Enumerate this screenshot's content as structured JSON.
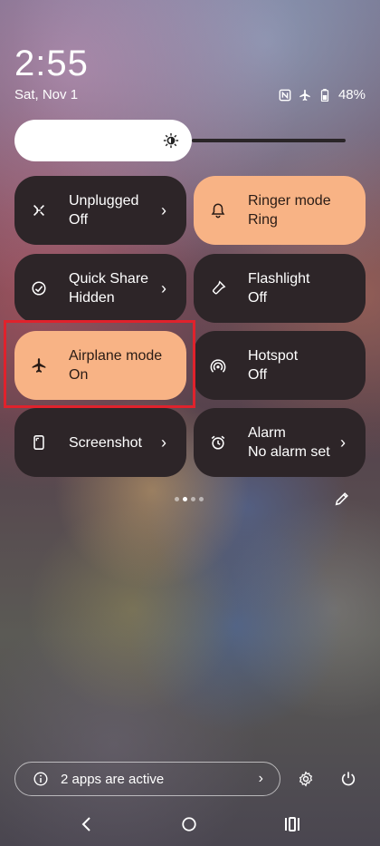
{
  "status_bar": {
    "time": "2:55",
    "date": "Sat, Nov 1",
    "battery": "48%",
    "icons": [
      "nfc-icon",
      "airplane-icon",
      "battery-icon"
    ]
  },
  "brightness": {
    "icon": "brightness-icon",
    "level": 0.45
  },
  "tiles": [
    {
      "label": "Unplugged",
      "status": "Off",
      "icon": "unplugged-icon",
      "active": false,
      "chevron": true
    },
    {
      "label": "Ringer mode",
      "status": "Ring",
      "icon": "bell-icon",
      "active": true,
      "chevron": false
    },
    {
      "label": "Quick Share",
      "status": "Hidden",
      "icon": "quick-share-icon",
      "active": false,
      "chevron": true
    },
    {
      "label": "Flashlight",
      "status": "Off",
      "icon": "flashlight-icon",
      "active": false,
      "chevron": false
    },
    {
      "label": "Airplane mode",
      "status": "On",
      "icon": "airplane-icon",
      "active": true,
      "chevron": false
    },
    {
      "label": "Hotspot",
      "status": "Off",
      "icon": "hotspot-icon",
      "active": false,
      "chevron": false
    },
    {
      "label": "Screenshot",
      "status": "",
      "icon": "screenshot-icon",
      "active": false,
      "chevron": true
    },
    {
      "label": "Alarm",
      "status": "No alarm set",
      "icon": "alarm-icon",
      "active": false,
      "chevron": true
    }
  ],
  "page_indicator": {
    "pages": 4,
    "current": 1
  },
  "footer": {
    "apps_active": "2 apps are active",
    "chevron": "›"
  },
  "chevron_glyph": "›",
  "colors": {
    "active_tile": "#f8b385",
    "inactive_tile": "#2d2528",
    "highlight": "#e0222c"
  }
}
